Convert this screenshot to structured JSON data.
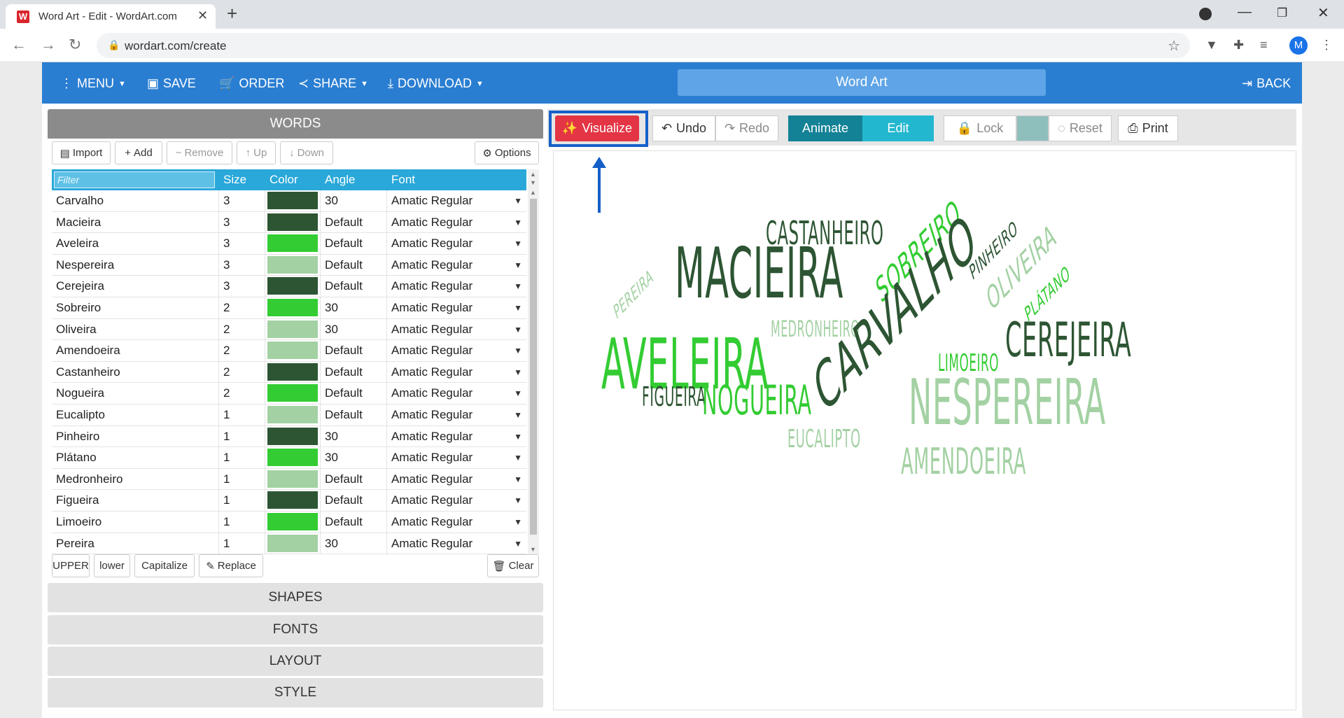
{
  "browser": {
    "tab_title": "Word Art - Edit - WordArt.com",
    "favicon_letter": "W",
    "url": "wordart.com/create",
    "profile_initial": "M"
  },
  "appbar": {
    "menu": "MENU",
    "save": "SAVE",
    "order": "ORDER",
    "share": "SHARE",
    "download": "DOWNLOAD",
    "title": "Word Art",
    "back": "BACK"
  },
  "words_panel": {
    "header": "WORDS",
    "toolbar": {
      "import": "Import",
      "add": "Add",
      "remove": "Remove",
      "up": "Up",
      "down": "Down",
      "options": "Options"
    },
    "columns": {
      "filter_placeholder": "Filter",
      "size": "Size",
      "color": "Color",
      "angle": "Angle",
      "font": "Font"
    },
    "rows": [
      {
        "word": "Carvalho",
        "size": "3",
        "color": "#2d5533",
        "angle": "30",
        "font": "Amatic Regular"
      },
      {
        "word": "Macieira",
        "size": "3",
        "color": "#2d5533",
        "angle": "Default",
        "font": "Amatic Regular"
      },
      {
        "word": "Aveleira",
        "size": "3",
        "color": "#33cc33",
        "angle": "Default",
        "font": "Amatic Regular"
      },
      {
        "word": "Nespereira",
        "size": "3",
        "color": "#a3d1a3",
        "angle": "Default",
        "font": "Amatic Regular"
      },
      {
        "word": "Cerejeira",
        "size": "3",
        "color": "#2d5533",
        "angle": "Default",
        "font": "Amatic Regular"
      },
      {
        "word": "Sobreiro",
        "size": "2",
        "color": "#33cc33",
        "angle": "30",
        "font": "Amatic Regular"
      },
      {
        "word": "Oliveira",
        "size": "2",
        "color": "#a3d1a3",
        "angle": "30",
        "font": "Amatic Regular"
      },
      {
        "word": "Amendoeira",
        "size": "2",
        "color": "#a3d1a3",
        "angle": "Default",
        "font": "Amatic Regular"
      },
      {
        "word": "Castanheiro",
        "size": "2",
        "color": "#2d5533",
        "angle": "Default",
        "font": "Amatic Regular"
      },
      {
        "word": "Nogueira",
        "size": "2",
        "color": "#33cc33",
        "angle": "Default",
        "font": "Amatic Regular"
      },
      {
        "word": "Eucalipto",
        "size": "1",
        "color": "#a3d1a3",
        "angle": "Default",
        "font": "Amatic Regular"
      },
      {
        "word": "Pinheiro",
        "size": "1",
        "color": "#2d5533",
        "angle": "30",
        "font": "Amatic Regular"
      },
      {
        "word": "Plátano",
        "size": "1",
        "color": "#33cc33",
        "angle": "30",
        "font": "Amatic Regular"
      },
      {
        "word": "Medronheiro",
        "size": "1",
        "color": "#a3d1a3",
        "angle": "Default",
        "font": "Amatic Regular"
      },
      {
        "word": "Figueira",
        "size": "1",
        "color": "#2d5533",
        "angle": "Default",
        "font": "Amatic Regular"
      },
      {
        "word": "Limoeiro",
        "size": "1",
        "color": "#33cc33",
        "angle": "Default",
        "font": "Amatic Regular"
      },
      {
        "word": "Pereira",
        "size": "1",
        "color": "#a3d1a3",
        "angle": "30",
        "font": "Amatic Regular"
      }
    ],
    "bottom": {
      "upper": "UPPER",
      "lower": "lower",
      "capitalize": "Capitalize",
      "replace": "Replace",
      "clear": "Clear"
    }
  },
  "sections": {
    "shapes": "SHAPES",
    "fonts": "FONTS",
    "layout": "LAYOUT",
    "style": "STYLE"
  },
  "canvas_toolbar": {
    "visualize": "Visualize",
    "undo": "Undo",
    "redo": "Redo",
    "animate": "Animate",
    "edit": "Edit",
    "lock": "Lock",
    "reset": "Reset",
    "print": "Print",
    "swatch_color": "#8fbfbd"
  },
  "cloud_words": [
    {
      "text": "CASTANHEIRO",
      "color": "#2d5533"
    },
    {
      "text": "MACIEIRA",
      "color": "#2d5533"
    },
    {
      "text": "SOBREIRO",
      "color": "#33cc33"
    },
    {
      "text": "PINHEIRO",
      "color": "#2d5533"
    },
    {
      "text": "OLIVEIRA",
      "color": "#a3d1a3"
    },
    {
      "text": "PLÁTANO",
      "color": "#33cc33"
    },
    {
      "text": "PEREIRA",
      "color": "#a3d1a3"
    },
    {
      "text": "MEDRONHEIRO",
      "color": "#a3d1a3"
    },
    {
      "text": "AVELEIRA",
      "color": "#33cc33"
    },
    {
      "text": "CARVALHO",
      "color": "#2d5533"
    },
    {
      "text": "LIMOEIRO",
      "color": "#33cc33"
    },
    {
      "text": "CEREJEIRA",
      "color": "#2d5533"
    },
    {
      "text": "FIGUEIRA",
      "color": "#2d5533"
    },
    {
      "text": "NOGUEIRA",
      "color": "#33cc33"
    },
    {
      "text": "NESPEREIRA",
      "color": "#a3d1a3"
    },
    {
      "text": "EUCALIPTO",
      "color": "#a3d1a3"
    },
    {
      "text": "AMENDOEIRA",
      "color": "#a3d1a3"
    }
  ]
}
